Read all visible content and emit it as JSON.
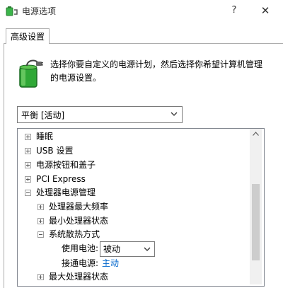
{
  "window": {
    "title": "电源选项",
    "help_glyph": "?",
    "close_glyph": "✕"
  },
  "tab": {
    "label": "高级设置"
  },
  "intro": {
    "line1": "选择你要自定义的电源计划，然后选择你希望计算机管理",
    "line2": "的电源设置。"
  },
  "plan": {
    "selected": "平衡 [活动]"
  },
  "tree": {
    "items": [
      {
        "label": "睡眠",
        "expanded": false
      },
      {
        "label": "USB 设置",
        "expanded": false
      },
      {
        "label": "电源按钮和盖子",
        "expanded": false
      },
      {
        "label": "PCI Express",
        "expanded": false
      },
      {
        "label": "处理器电源管理",
        "expanded": true
      },
      {
        "label": "处理器最大频率",
        "expanded": false
      },
      {
        "label": "最小处理器状态",
        "expanded": false
      },
      {
        "label": "系统散热方式",
        "expanded": true
      },
      {
        "label": "最大处理器状态",
        "expanded": false
      }
    ],
    "battery_label": "使用电池:",
    "battery_value": "被动",
    "plugged_label": "接通电源:",
    "plugged_value": "主动"
  },
  "icons": {
    "app": "power-options-icon",
    "battery": "battery-plug-icon"
  },
  "colors": {
    "link": "#0066cc",
    "battery_green": "#2fa836"
  }
}
